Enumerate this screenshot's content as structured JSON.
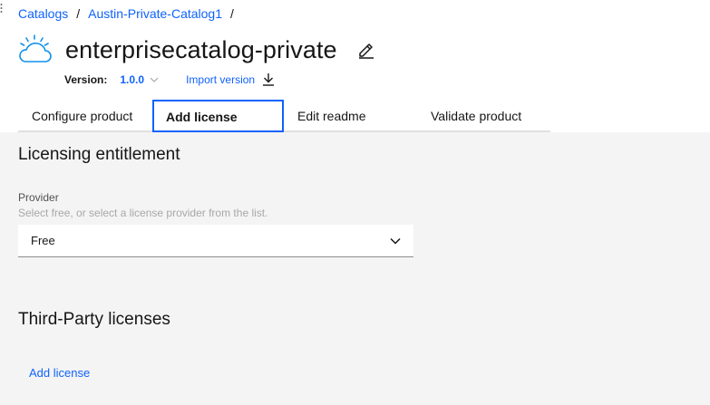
{
  "breadcrumb": {
    "items": [
      "Catalogs",
      "Austin-Private-Catalog1"
    ],
    "separator": "/"
  },
  "header": {
    "title": "enterprisecatalog-private",
    "logo_icon": "cloud-icon",
    "edit_icon": "pencil-icon"
  },
  "version": {
    "label": "Version:",
    "value": "1.0.0",
    "import_label": "Import version"
  },
  "tabs": [
    {
      "label": "Configure product",
      "active": false
    },
    {
      "label": "Add license",
      "active": true
    },
    {
      "label": "Edit readme",
      "active": false
    },
    {
      "label": "Validate product",
      "active": false
    }
  ],
  "licensing": {
    "title": "Licensing entitlement",
    "provider_label": "Provider",
    "provider_helper": "Select free, or select a license provider from the list.",
    "provider_value": "Free"
  },
  "third_party": {
    "title": "Third-Party licenses",
    "add_label": "Add license"
  },
  "colors": {
    "accent": "#0f62fe",
    "panel_bg": "#f4f4f4",
    "logo": "#1192e8"
  }
}
